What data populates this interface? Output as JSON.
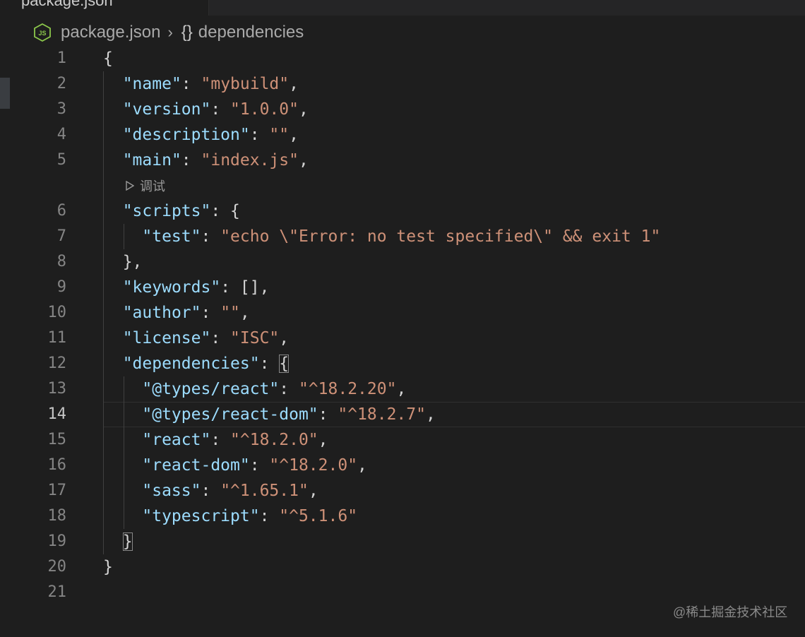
{
  "tab": {
    "label": "package.json"
  },
  "breadcrumb": {
    "file": "package.json",
    "braces": "{}",
    "symbol": "dependencies"
  },
  "file_icon": {
    "name": "nodejs-icon",
    "text": "JS",
    "color": "#8cc84b"
  },
  "codelens": {
    "label": "调试"
  },
  "current_line": 14,
  "lines": [
    {
      "num": "1",
      "tokens": [
        {
          "t": "p",
          "v": "{"
        }
      ]
    },
    {
      "num": "2",
      "tokens": [
        {
          "t": "p",
          "v": "  "
        },
        {
          "t": "k",
          "v": "\"name\""
        },
        {
          "t": "p",
          "v": ": "
        },
        {
          "t": "s",
          "v": "\"mybuild\""
        },
        {
          "t": "p",
          "v": ","
        }
      ]
    },
    {
      "num": "3",
      "tokens": [
        {
          "t": "p",
          "v": "  "
        },
        {
          "t": "k",
          "v": "\"version\""
        },
        {
          "t": "p",
          "v": ": "
        },
        {
          "t": "s",
          "v": "\"1.0.0\""
        },
        {
          "t": "p",
          "v": ","
        }
      ]
    },
    {
      "num": "4",
      "tokens": [
        {
          "t": "p",
          "v": "  "
        },
        {
          "t": "k",
          "v": "\"description\""
        },
        {
          "t": "p",
          "v": ": "
        },
        {
          "t": "s",
          "v": "\"\""
        },
        {
          "t": "p",
          "v": ","
        }
      ]
    },
    {
      "num": "5",
      "tokens": [
        {
          "t": "p",
          "v": "  "
        },
        {
          "t": "k",
          "v": "\"main\""
        },
        {
          "t": "p",
          "v": ": "
        },
        {
          "t": "s",
          "v": "\"index.js\""
        },
        {
          "t": "p",
          "v": ","
        }
      ],
      "codelens_after": true
    },
    {
      "num": "6",
      "tokens": [
        {
          "t": "p",
          "v": "  "
        },
        {
          "t": "k",
          "v": "\"scripts\""
        },
        {
          "t": "p",
          "v": ": {"
        }
      ]
    },
    {
      "num": "7",
      "tokens": [
        {
          "t": "p",
          "v": "    "
        },
        {
          "t": "k",
          "v": "\"test\""
        },
        {
          "t": "p",
          "v": ": "
        },
        {
          "t": "s",
          "v": "\"echo \\\"Error: no test specified\\\" && exit 1\""
        }
      ]
    },
    {
      "num": "8",
      "tokens": [
        {
          "t": "p",
          "v": "  },"
        }
      ]
    },
    {
      "num": "9",
      "tokens": [
        {
          "t": "p",
          "v": "  "
        },
        {
          "t": "k",
          "v": "\"keywords\""
        },
        {
          "t": "p",
          "v": ": [],"
        }
      ]
    },
    {
      "num": "10",
      "tokens": [
        {
          "t": "p",
          "v": "  "
        },
        {
          "t": "k",
          "v": "\"author\""
        },
        {
          "t": "p",
          "v": ": "
        },
        {
          "t": "s",
          "v": "\"\""
        },
        {
          "t": "p",
          "v": ","
        }
      ]
    },
    {
      "num": "11",
      "tokens": [
        {
          "t": "p",
          "v": "  "
        },
        {
          "t": "k",
          "v": "\"license\""
        },
        {
          "t": "p",
          "v": ": "
        },
        {
          "t": "s",
          "v": "\"ISC\""
        },
        {
          "t": "p",
          "v": ","
        }
      ]
    },
    {
      "num": "12",
      "tokens": [
        {
          "t": "p",
          "v": "  "
        },
        {
          "t": "k",
          "v": "\"dependencies\""
        },
        {
          "t": "p",
          "v": ": "
        },
        {
          "t": "p",
          "v": "{",
          "match": true
        }
      ]
    },
    {
      "num": "13",
      "tokens": [
        {
          "t": "p",
          "v": "    "
        },
        {
          "t": "k",
          "v": "\"@types/react\""
        },
        {
          "t": "p",
          "v": ": "
        },
        {
          "t": "s",
          "v": "\"^18.2.20\""
        },
        {
          "t": "p",
          "v": ","
        }
      ]
    },
    {
      "num": "14",
      "tokens": [
        {
          "t": "p",
          "v": "    "
        },
        {
          "t": "k",
          "v": "\"@types/react-dom\""
        },
        {
          "t": "p",
          "v": ": "
        },
        {
          "t": "s",
          "v": "\"^18.2.7\""
        },
        {
          "t": "p",
          "v": ","
        }
      ]
    },
    {
      "num": "15",
      "tokens": [
        {
          "t": "p",
          "v": "    "
        },
        {
          "t": "k",
          "v": "\"react\""
        },
        {
          "t": "p",
          "v": ": "
        },
        {
          "t": "s",
          "v": "\"^18.2.0\""
        },
        {
          "t": "p",
          "v": ","
        }
      ]
    },
    {
      "num": "16",
      "tokens": [
        {
          "t": "p",
          "v": "    "
        },
        {
          "t": "k",
          "v": "\"react-dom\""
        },
        {
          "t": "p",
          "v": ": "
        },
        {
          "t": "s",
          "v": "\"^18.2.0\""
        },
        {
          "t": "p",
          "v": ","
        }
      ]
    },
    {
      "num": "17",
      "tokens": [
        {
          "t": "p",
          "v": "    "
        },
        {
          "t": "k",
          "v": "\"sass\""
        },
        {
          "t": "p",
          "v": ": "
        },
        {
          "t": "s",
          "v": "\"^1.65.1\""
        },
        {
          "t": "p",
          "v": ","
        }
      ]
    },
    {
      "num": "18",
      "tokens": [
        {
          "t": "p",
          "v": "    "
        },
        {
          "t": "k",
          "v": "\"typescript\""
        },
        {
          "t": "p",
          "v": ": "
        },
        {
          "t": "s",
          "v": "\"^5.1.6\""
        }
      ]
    },
    {
      "num": "19",
      "tokens": [
        {
          "t": "p",
          "v": "  "
        },
        {
          "t": "p",
          "v": "}",
          "match": true
        }
      ]
    },
    {
      "num": "20",
      "tokens": [
        {
          "t": "p",
          "v": "}"
        }
      ]
    },
    {
      "num": "21",
      "tokens": []
    }
  ],
  "watermark": "@稀土掘金技术社区",
  "colors": {
    "key": "#9cdcfe",
    "string": "#ce9178",
    "punctuation": "#d4d4d4",
    "background": "#1e1e1e",
    "line_number": "#858585"
  }
}
